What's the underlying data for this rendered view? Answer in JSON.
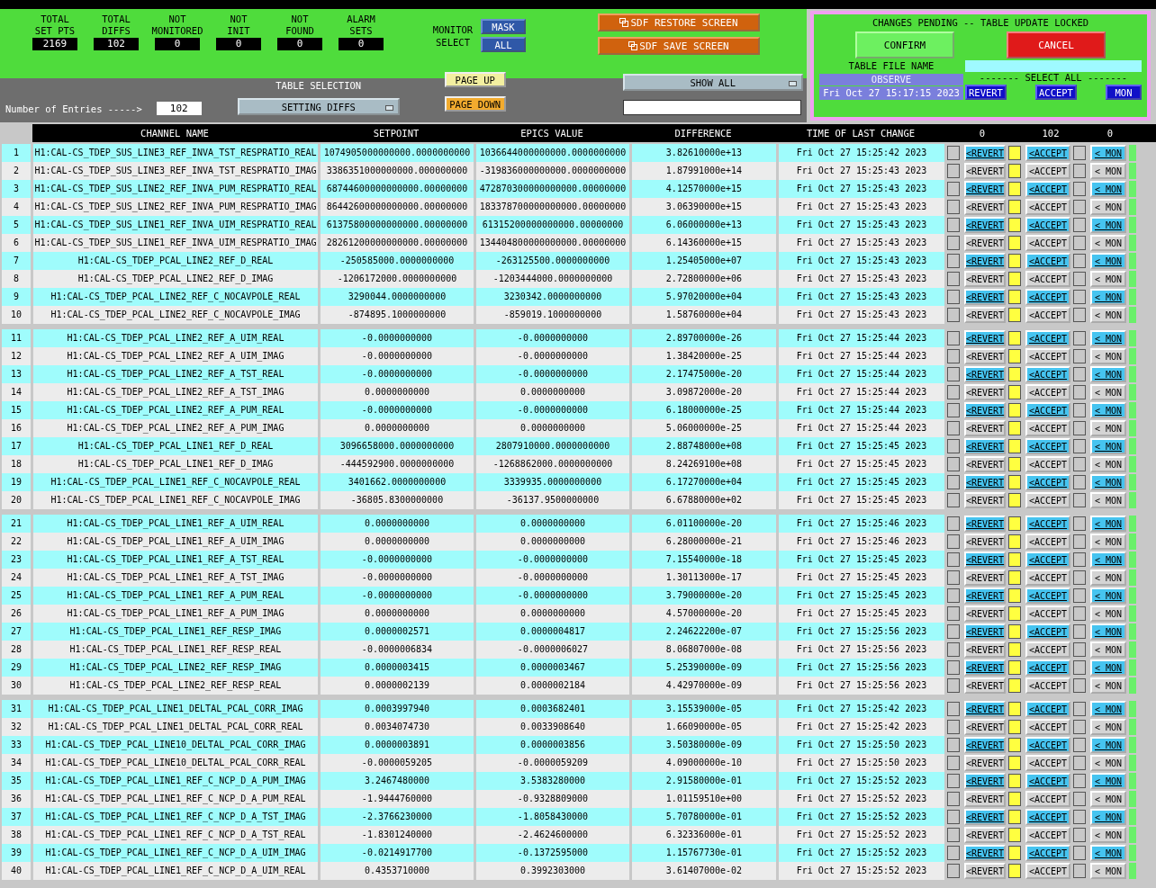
{
  "summary": [
    {
      "label": "TOTAL SET PTS",
      "value": "2169"
    },
    {
      "label": "TOTAL DIFFS",
      "value": "102"
    },
    {
      "label": "NOT MONITORED",
      "value": "0"
    },
    {
      "label": "NOT INIT",
      "value": "0"
    },
    {
      "label": "NOT FOUND",
      "value": "0"
    },
    {
      "label": "ALARM SETS",
      "value": "0"
    }
  ],
  "monitor_select": {
    "label": "MONITOR SELECT",
    "buttons": [
      "MASK",
      "ALL"
    ]
  },
  "screen_buttons": [
    "SDF RESTORE SCREEN",
    "SDF SAVE SCREEN"
  ],
  "entries": {
    "label": "Number of Entries ----->",
    "value": "102"
  },
  "table_selection": {
    "label": "TABLE SELECTION",
    "value": "SETTING DIFFS"
  },
  "page_buttons": [
    "PAGE UP",
    "PAGE DOWN"
  ],
  "filter_menu": "SHOW ALL",
  "pending": {
    "title": "CHANGES PENDING -- TABLE UPDATE LOCKED",
    "confirm": "CONFIRM",
    "cancel": "CANCEL",
    "file_label": "TABLE FILE NAME",
    "file_value": "OBSERVE",
    "file_time": "Fri Oct 27 15:17:15 2023",
    "select_all_label": "------- SELECT ALL -------",
    "select_all_buttons": [
      "REVERT",
      "ACCEPT",
      "MON"
    ]
  },
  "table": {
    "columns": [
      "CHANNEL NAME",
      "SETPOINT",
      "EPICS VALUE",
      "DIFFERENCE",
      "TIME OF LAST CHANGE"
    ],
    "counts": [
      "0",
      "102",
      "0"
    ],
    "rows": [
      {
        "n": "1",
        "channel": "H1:CAL-CS_TDEP_SUS_LINE3_REF_INVA_TST_RESPRATIO_REAL",
        "setpoint": "1074905000000000.0000000000",
        "epics": "1036644000000000.0000000000",
        "diff": "3.82610000e+13",
        "time": "Fri Oct 27 15:25:42 2023",
        "revert": "<REVERT",
        "accept": "<ACCEPT",
        "mon": "< MON",
        "revert_checked": false,
        "accept_checked": true,
        "mon_checked": false
      },
      {
        "n": "2",
        "channel": "H1:CAL-CS_TDEP_SUS_LINE3_REF_INVA_TST_RESPRATIO_IMAG",
        "setpoint": "3386351000000000.000000000",
        "epics": "-319836000000000.0000000000",
        "diff": "1.87991000e+14",
        "time": "Fri Oct 27 15:25:43 2023",
        "revert": "<REVERT",
        "accept": "<ACCEPT",
        "mon": "< MON",
        "revert_checked": false,
        "accept_checked": true,
        "mon_checked": false
      },
      {
        "n": "3",
        "channel": "H1:CAL-CS_TDEP_SUS_LINE2_REF_INVA_PUM_RESPRATIO_REAL",
        "setpoint": "68744600000000000.00000000",
        "epics": "472870300000000000.00000000",
        "diff": "4.12570000e+15",
        "time": "Fri Oct 27 15:25:43 2023",
        "revert": "<REVERT",
        "accept": "<ACCEPT",
        "mon": "< MON",
        "revert_checked": false,
        "accept_checked": true,
        "mon_checked": false
      },
      {
        "n": "4",
        "channel": "H1:CAL-CS_TDEP_SUS_LINE2_REF_INVA_PUM_RESPRATIO_IMAG",
        "setpoint": "86442600000000000.00000000",
        "epics": "183378700000000000.00000000",
        "diff": "3.06390000e+15",
        "time": "Fri Oct 27 15:25:43 2023",
        "revert": "<REVERT",
        "accept": "<ACCEPT",
        "mon": "< MON",
        "revert_checked": false,
        "accept_checked": true,
        "mon_checked": false
      },
      {
        "n": "5",
        "channel": "H1:CAL-CS_TDEP_SUS_LINE1_REF_INVA_UIM_RESPRATIO_REAL",
        "setpoint": "61375800000000000.00000000",
        "epics": "61315200000000000.00000000",
        "diff": "6.06000000e+13",
        "time": "Fri Oct 27 15:25:43 2023",
        "revert": "<REVERT",
        "accept": "<ACCEPT",
        "mon": "< MON",
        "revert_checked": false,
        "accept_checked": true,
        "mon_checked": false
      },
      {
        "n": "6",
        "channel": "H1:CAL-CS_TDEP_SUS_LINE1_REF_INVA_UIM_RESPRATIO_IMAG",
        "setpoint": "28261200000000000.00000000",
        "epics": "134404800000000000.00000000",
        "diff": "6.14360000e+15",
        "time": "Fri Oct 27 15:25:43 2023",
        "revert": "<REVERT",
        "accept": "<ACCEPT",
        "mon": "< MON",
        "revert_checked": false,
        "accept_checked": true,
        "mon_checked": false
      },
      {
        "n": "7",
        "channel": "H1:CAL-CS_TDEP_PCAL_LINE2_REF_D_REAL",
        "setpoint": "-250585000.0000000000",
        "epics": "-263125500.0000000000",
        "diff": "1.25405000e+07",
        "time": "Fri Oct 27 15:25:43 2023",
        "revert": "<REVERT",
        "accept": "<ACCEPT",
        "mon": "< MON",
        "revert_checked": false,
        "accept_checked": true,
        "mon_checked": false
      },
      {
        "n": "8",
        "channel": "H1:CAL-CS_TDEP_PCAL_LINE2_REF_D_IMAG",
        "setpoint": "-1206172000.0000000000",
        "epics": "-1203444000.0000000000",
        "diff": "2.72800000e+06",
        "time": "Fri Oct 27 15:25:43 2023",
        "revert": "<REVERT",
        "accept": "<ACCEPT",
        "mon": "< MON",
        "revert_checked": false,
        "accept_checked": true,
        "mon_checked": false
      },
      {
        "n": "9",
        "channel": "H1:CAL-CS_TDEP_PCAL_LINE2_REF_C_NOCAVPOLE_REAL",
        "setpoint": "3290044.0000000000",
        "epics": "3230342.0000000000",
        "diff": "5.97020000e+04",
        "time": "Fri Oct 27 15:25:43 2023",
        "revert": "<REVERT",
        "accept": "<ACCEPT",
        "mon": "< MON",
        "revert_checked": false,
        "accept_checked": true,
        "mon_checked": false
      },
      {
        "n": "10",
        "channel": "H1:CAL-CS_TDEP_PCAL_LINE2_REF_C_NOCAVPOLE_IMAG",
        "setpoint": "-874895.1000000000",
        "epics": "-859019.1000000000",
        "diff": "1.58760000e+04",
        "time": "Fri Oct 27 15:25:43 2023",
        "revert": "<REVERT",
        "accept": "<ACCEPT",
        "mon": "< MON",
        "revert_checked": false,
        "accept_checked": true,
        "mon_checked": false
      },
      {
        "n": "11",
        "channel": "H1:CAL-CS_TDEP_PCAL_LINE2_REF_A_UIM_REAL",
        "setpoint": "-0.0000000000",
        "epics": "-0.0000000000",
        "diff": "2.89700000e-26",
        "time": "Fri Oct 27 15:25:44 2023",
        "revert": "<REVERT",
        "accept": "<ACCEPT",
        "mon": "< MON",
        "revert_checked": false,
        "accept_checked": true,
        "mon_checked": false
      },
      {
        "n": "12",
        "channel": "H1:CAL-CS_TDEP_PCAL_LINE2_REF_A_UIM_IMAG",
        "setpoint": "-0.0000000000",
        "epics": "-0.0000000000",
        "diff": "1.38420000e-25",
        "time": "Fri Oct 27 15:25:44 2023",
        "revert": "<REVERT",
        "accept": "<ACCEPT",
        "mon": "< MON",
        "revert_checked": false,
        "accept_checked": true,
        "mon_checked": false
      },
      {
        "n": "13",
        "channel": "H1:CAL-CS_TDEP_PCAL_LINE2_REF_A_TST_REAL",
        "setpoint": "-0.0000000000",
        "epics": "-0.0000000000",
        "diff": "2.17475000e-20",
        "time": "Fri Oct 27 15:25:44 2023",
        "revert": "<REVERT",
        "accept": "<ACCEPT",
        "mon": "< MON",
        "revert_checked": false,
        "accept_checked": true,
        "mon_checked": false
      },
      {
        "n": "14",
        "channel": "H1:CAL-CS_TDEP_PCAL_LINE2_REF_A_TST_IMAG",
        "setpoint": "0.0000000000",
        "epics": "0.0000000000",
        "diff": "3.09872000e-20",
        "time": "Fri Oct 27 15:25:44 2023",
        "revert": "<REVERT",
        "accept": "<ACCEPT",
        "mon": "< MON",
        "revert_checked": false,
        "accept_checked": true,
        "mon_checked": false
      },
      {
        "n": "15",
        "channel": "H1:CAL-CS_TDEP_PCAL_LINE2_REF_A_PUM_REAL",
        "setpoint": "-0.0000000000",
        "epics": "-0.0000000000",
        "diff": "6.18000000e-25",
        "time": "Fri Oct 27 15:25:44 2023",
        "revert": "<REVERT",
        "accept": "<ACCEPT",
        "mon": "< MON",
        "revert_checked": false,
        "accept_checked": true,
        "mon_checked": false
      },
      {
        "n": "16",
        "channel": "H1:CAL-CS_TDEP_PCAL_LINE2_REF_A_PUM_IMAG",
        "setpoint": "0.0000000000",
        "epics": "0.0000000000",
        "diff": "5.06000000e-25",
        "time": "Fri Oct 27 15:25:44 2023",
        "revert": "<REVERT",
        "accept": "<ACCEPT",
        "mon": "< MON",
        "revert_checked": false,
        "accept_checked": true,
        "mon_checked": false
      },
      {
        "n": "17",
        "channel": "H1:CAL-CS_TDEP_PCAL_LINE1_REF_D_REAL",
        "setpoint": "3096658000.0000000000",
        "epics": "2807910000.0000000000",
        "diff": "2.88748000e+08",
        "time": "Fri Oct 27 15:25:45 2023",
        "revert": "<REVERT",
        "accept": "<ACCEPT",
        "mon": "< MON",
        "revert_checked": false,
        "accept_checked": true,
        "mon_checked": false
      },
      {
        "n": "18",
        "channel": "H1:CAL-CS_TDEP_PCAL_LINE1_REF_D_IMAG",
        "setpoint": "-444592900.0000000000",
        "epics": "-1268862000.0000000000",
        "diff": "8.24269100e+08",
        "time": "Fri Oct 27 15:25:45 2023",
        "revert": "<REVERT",
        "accept": "<ACCEPT",
        "mon": "< MON",
        "revert_checked": false,
        "accept_checked": true,
        "mon_checked": false
      },
      {
        "n": "19",
        "channel": "H1:CAL-CS_TDEP_PCAL_LINE1_REF_C_NOCAVPOLE_REAL",
        "setpoint": "3401662.0000000000",
        "epics": "3339935.0000000000",
        "diff": "6.17270000e+04",
        "time": "Fri Oct 27 15:25:45 2023",
        "revert": "<REVERT",
        "accept": "<ACCEPT",
        "mon": "< MON",
        "revert_checked": false,
        "accept_checked": true,
        "mon_checked": false
      },
      {
        "n": "20",
        "channel": "H1:CAL-CS_TDEP_PCAL_LINE1_REF_C_NOCAVPOLE_IMAG",
        "setpoint": "-36805.8300000000",
        "epics": "-36137.9500000000",
        "diff": "6.67880000e+02",
        "time": "Fri Oct 27 15:25:45 2023",
        "revert": "<REVERT",
        "accept": "<ACCEPT",
        "mon": "< MON",
        "revert_checked": false,
        "accept_checked": true,
        "mon_checked": false
      },
      {
        "n": "21",
        "channel": "H1:CAL-CS_TDEP_PCAL_LINE1_REF_A_UIM_REAL",
        "setpoint": "0.0000000000",
        "epics": "0.0000000000",
        "diff": "6.01100000e-20",
        "time": "Fri Oct 27 15:25:46 2023",
        "revert": "<REVERT",
        "accept": "<ACCEPT",
        "mon": "< MON",
        "revert_checked": false,
        "accept_checked": true,
        "mon_checked": false
      },
      {
        "n": "22",
        "channel": "H1:CAL-CS_TDEP_PCAL_LINE1_REF_A_UIM_IMAG",
        "setpoint": "0.0000000000",
        "epics": "0.0000000000",
        "diff": "6.28000000e-21",
        "time": "Fri Oct 27 15:25:46 2023",
        "revert": "<REVERT",
        "accept": "<ACCEPT",
        "mon": "< MON",
        "revert_checked": false,
        "accept_checked": true,
        "mon_checked": false
      },
      {
        "n": "23",
        "channel": "H1:CAL-CS_TDEP_PCAL_LINE1_REF_A_TST_REAL",
        "setpoint": "-0.0000000000",
        "epics": "-0.0000000000",
        "diff": "7.15540000e-18",
        "time": "Fri Oct 27 15:25:45 2023",
        "revert": "<REVERT",
        "accept": "<ACCEPT",
        "mon": "< MON",
        "revert_checked": false,
        "accept_checked": true,
        "mon_checked": false
      },
      {
        "n": "24",
        "channel": "H1:CAL-CS_TDEP_PCAL_LINE1_REF_A_TST_IMAG",
        "setpoint": "-0.0000000000",
        "epics": "-0.0000000000",
        "diff": "1.30113000e-17",
        "time": "Fri Oct 27 15:25:45 2023",
        "revert": "<REVERT",
        "accept": "<ACCEPT",
        "mon": "< MON",
        "revert_checked": false,
        "accept_checked": true,
        "mon_checked": false
      },
      {
        "n": "25",
        "channel": "H1:CAL-CS_TDEP_PCAL_LINE1_REF_A_PUM_REAL",
        "setpoint": "-0.0000000000",
        "epics": "-0.0000000000",
        "diff": "3.79000000e-20",
        "time": "Fri Oct 27 15:25:45 2023",
        "revert": "<REVERT",
        "accept": "<ACCEPT",
        "mon": "< MON",
        "revert_checked": false,
        "accept_checked": true,
        "mon_checked": false
      },
      {
        "n": "26",
        "channel": "H1:CAL-CS_TDEP_PCAL_LINE1_REF_A_PUM_IMAG",
        "setpoint": "0.0000000000",
        "epics": "0.0000000000",
        "diff": "4.57000000e-20",
        "time": "Fri Oct 27 15:25:45 2023",
        "revert": "<REVERT",
        "accept": "<ACCEPT",
        "mon": "< MON",
        "revert_checked": false,
        "accept_checked": true,
        "mon_checked": false
      },
      {
        "n": "27",
        "channel": "H1:CAL-CS_TDEP_PCAL_LINE1_REF_RESP_IMAG",
        "setpoint": "0.0000002571",
        "epics": "0.0000004817",
        "diff": "2.24622200e-07",
        "time": "Fri Oct 27 15:25:56 2023",
        "revert": "<REVERT",
        "accept": "<ACCEPT",
        "mon": "< MON",
        "revert_checked": false,
        "accept_checked": true,
        "mon_checked": false
      },
      {
        "n": "28",
        "channel": "H1:CAL-CS_TDEP_PCAL_LINE1_REF_RESP_REAL",
        "setpoint": "-0.0000006834",
        "epics": "-0.0000006027",
        "diff": "8.06807000e-08",
        "time": "Fri Oct 27 15:25:56 2023",
        "revert": "<REVERT",
        "accept": "<ACCEPT",
        "mon": "< MON",
        "revert_checked": false,
        "accept_checked": true,
        "mon_checked": false
      },
      {
        "n": "29",
        "channel": "H1:CAL-CS_TDEP_PCAL_LINE2_REF_RESP_IMAG",
        "setpoint": "0.0000003415",
        "epics": "0.0000003467",
        "diff": "5.25390000e-09",
        "time": "Fri Oct 27 15:25:56 2023",
        "revert": "<REVERT",
        "accept": "<ACCEPT",
        "mon": "< MON",
        "revert_checked": false,
        "accept_checked": true,
        "mon_checked": false
      },
      {
        "n": "30",
        "channel": "H1:CAL-CS_TDEP_PCAL_LINE2_REF_RESP_REAL",
        "setpoint": "0.0000002139",
        "epics": "0.0000002184",
        "diff": "4.42970000e-09",
        "time": "Fri Oct 27 15:25:56 2023",
        "revert": "<REVERT",
        "accept": "<ACCEPT",
        "mon": "< MON",
        "revert_checked": false,
        "accept_checked": true,
        "mon_checked": false
      },
      {
        "n": "31",
        "channel": "H1:CAL-CS_TDEP_PCAL_LINE1_DELTAL_PCAL_CORR_IMAG",
        "setpoint": "0.0003997940",
        "epics": "0.0003682401",
        "diff": "3.15539000e-05",
        "time": "Fri Oct 27 15:25:42 2023",
        "revert": "<REVERT",
        "accept": "<ACCEPT",
        "mon": "< MON",
        "revert_checked": false,
        "accept_checked": true,
        "mon_checked": false
      },
      {
        "n": "32",
        "channel": "H1:CAL-CS_TDEP_PCAL_LINE1_DELTAL_PCAL_CORR_REAL",
        "setpoint": "0.0034074730",
        "epics": "0.0033908640",
        "diff": "1.66090000e-05",
        "time": "Fri Oct 27 15:25:42 2023",
        "revert": "<REVERT",
        "accept": "<ACCEPT",
        "mon": "< MON",
        "revert_checked": false,
        "accept_checked": true,
        "mon_checked": false
      },
      {
        "n": "33",
        "channel": "H1:CAL-CS_TDEP_PCAL_LINE10_DELTAL_PCAL_CORR_IMAG",
        "setpoint": "0.0000003891",
        "epics": "0.0000003856",
        "diff": "3.50380000e-09",
        "time": "Fri Oct 27 15:25:50 2023",
        "revert": "<REVERT",
        "accept": "<ACCEPT",
        "mon": "< MON",
        "revert_checked": false,
        "accept_checked": true,
        "mon_checked": false
      },
      {
        "n": "34",
        "channel": "H1:CAL-CS_TDEP_PCAL_LINE10_DELTAL_PCAL_CORR_REAL",
        "setpoint": "-0.0000059205",
        "epics": "-0.0000059209",
        "diff": "4.09000000e-10",
        "time": "Fri Oct 27 15:25:50 2023",
        "revert": "<REVERT",
        "accept": "<ACCEPT",
        "mon": "< MON",
        "revert_checked": false,
        "accept_checked": true,
        "mon_checked": false
      },
      {
        "n": "35",
        "channel": "H1:CAL-CS_TDEP_PCAL_LINE1_REF_C_NCP_D_A_PUM_IMAG",
        "setpoint": "3.2467480000",
        "epics": "3.5383280000",
        "diff": "2.91580000e-01",
        "time": "Fri Oct 27 15:25:52 2023",
        "revert": "<REVERT",
        "accept": "<ACCEPT",
        "mon": "< MON",
        "revert_checked": false,
        "accept_checked": true,
        "mon_checked": false
      },
      {
        "n": "36",
        "channel": "H1:CAL-CS_TDEP_PCAL_LINE1_REF_C_NCP_D_A_PUM_REAL",
        "setpoint": "-1.9444760000",
        "epics": "-0.9328809000",
        "diff": "1.01159510e+00",
        "time": "Fri Oct 27 15:25:52 2023",
        "revert": "<REVERT",
        "accept": "<ACCEPT",
        "mon": "< MON",
        "revert_checked": false,
        "accept_checked": true,
        "mon_checked": false
      },
      {
        "n": "37",
        "channel": "H1:CAL-CS_TDEP_PCAL_LINE1_REF_C_NCP_D_A_TST_IMAG",
        "setpoint": "-2.3766230000",
        "epics": "-1.8058430000",
        "diff": "5.70780000e-01",
        "time": "Fri Oct 27 15:25:52 2023",
        "revert": "<REVERT",
        "accept": "<ACCEPT",
        "mon": "< MON",
        "revert_checked": false,
        "accept_checked": true,
        "mon_checked": false
      },
      {
        "n": "38",
        "channel": "H1:CAL-CS_TDEP_PCAL_LINE1_REF_C_NCP_D_A_TST_REAL",
        "setpoint": "-1.8301240000",
        "epics": "-2.4624600000",
        "diff": "6.32336000e-01",
        "time": "Fri Oct 27 15:25:52 2023",
        "revert": "<REVERT",
        "accept": "<ACCEPT",
        "mon": "< MON",
        "revert_checked": false,
        "accept_checked": true,
        "mon_checked": false
      },
      {
        "n": "39",
        "channel": "H1:CAL-CS_TDEP_PCAL_LINE1_REF_C_NCP_D_A_UIM_IMAG",
        "setpoint": "-0.0214917700",
        "epics": "-0.1372595000",
        "diff": "1.15767730e-01",
        "time": "Fri Oct 27 15:25:52 2023",
        "revert": "<REVERT",
        "accept": "<ACCEPT",
        "mon": "< MON",
        "revert_checked": false,
        "accept_checked": true,
        "mon_checked": false
      },
      {
        "n": "40",
        "channel": "H1:CAL-CS_TDEP_PCAL_LINE1_REF_C_NCP_D_A_UIM_REAL",
        "setpoint": "0.4353710000",
        "epics": "0.3992303000",
        "diff": "3.61407000e-02",
        "time": "Fri Oct 27 15:25:52 2023",
        "revert": "<REVERT",
        "accept": "<ACCEPT",
        "mon": "< MON",
        "revert_checked": false,
        "accept_checked": true,
        "mon_checked": false
      }
    ]
  }
}
